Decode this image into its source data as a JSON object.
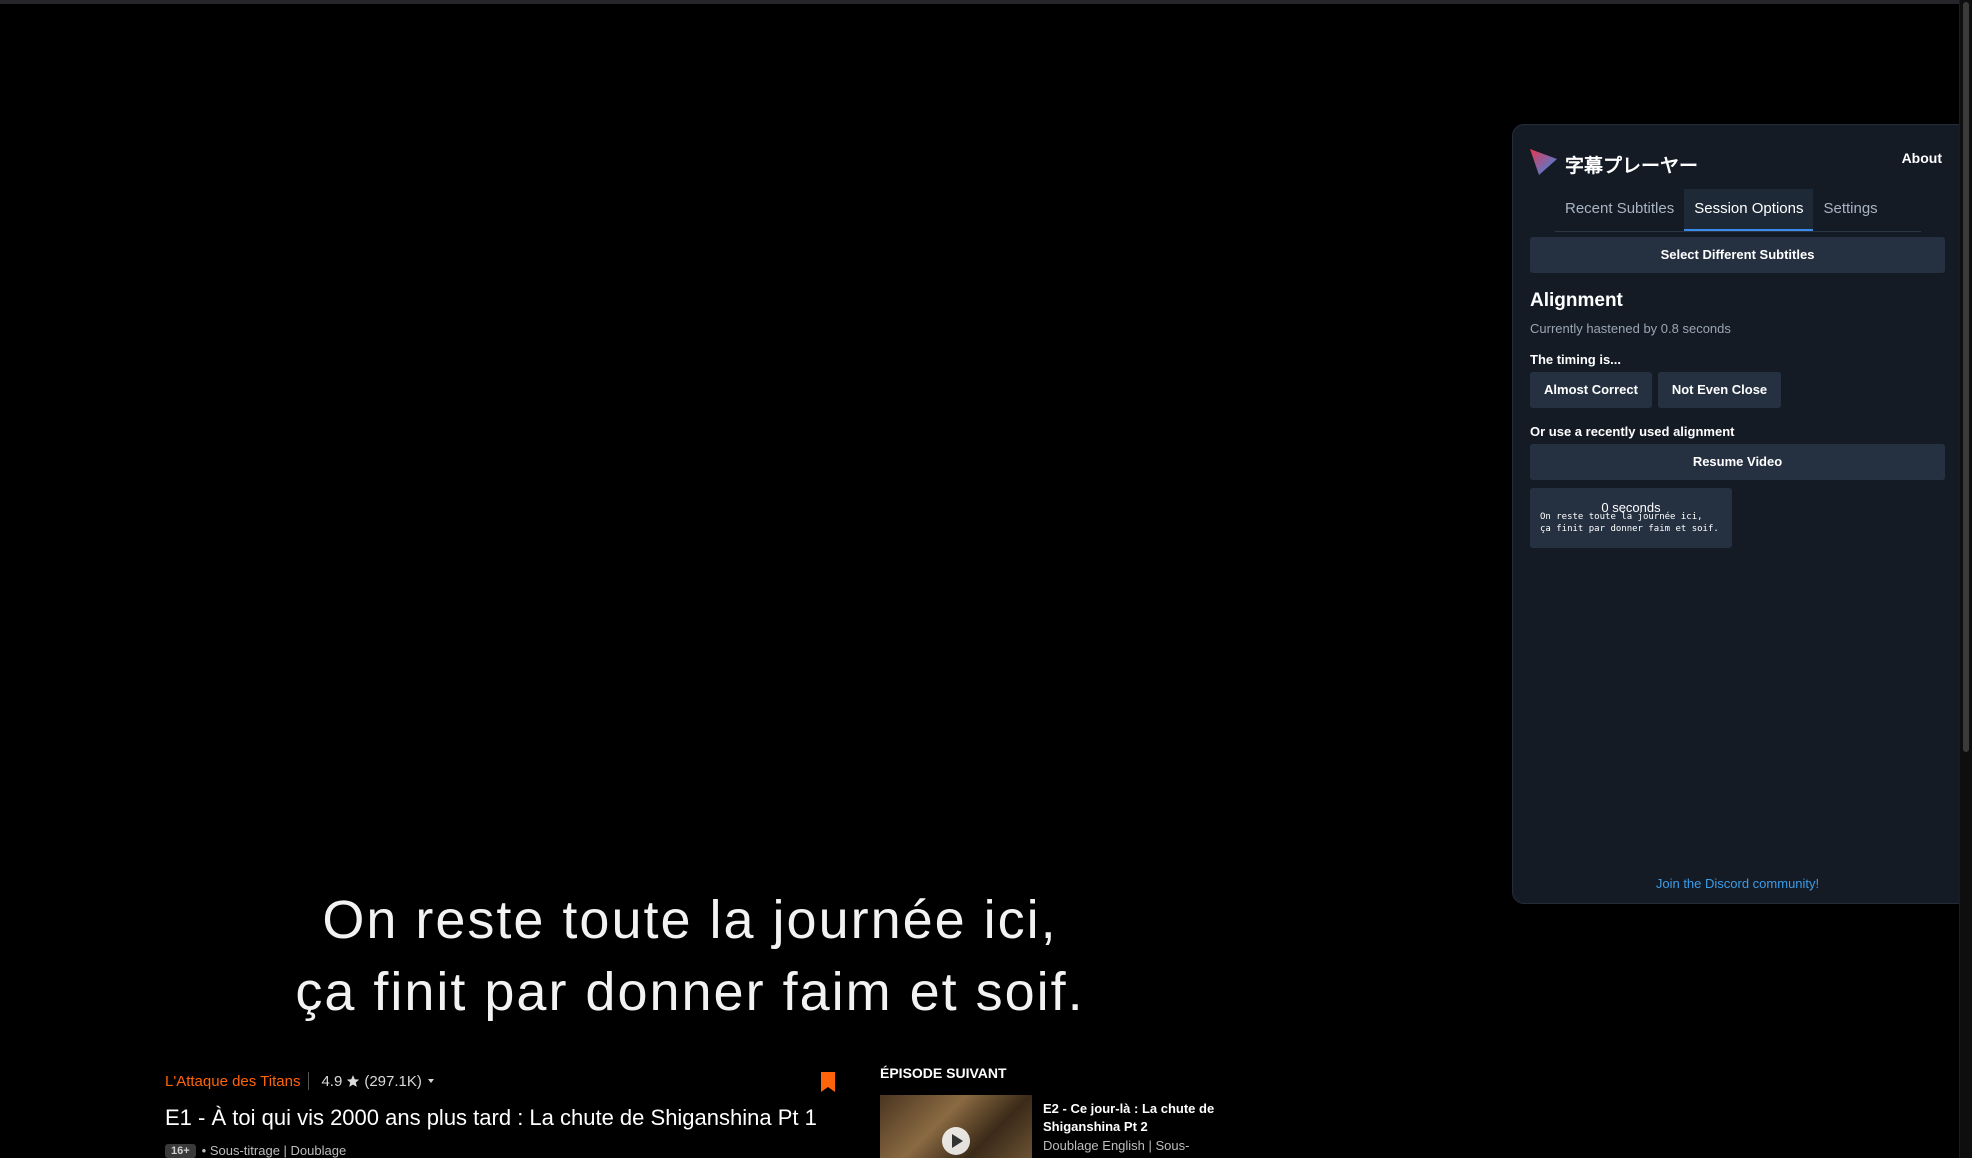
{
  "subtitle": {
    "line1": "On reste toute la journée ici,",
    "line2": "ça finit par donner faim et soif."
  },
  "episode": {
    "series": "L'Attaque des Titans",
    "rating": "4.9",
    "rating_count": "(297.1K)",
    "title": "E1 - À toi qui vis 2000 ans plus tard : La chute de Shiganshina Pt 1",
    "age_badge": "16+",
    "audio": "• Sous-titrage | Doublage"
  },
  "next_episode": {
    "heading": "ÉPISODE SUIVANT",
    "title": "E2 - Ce jour-là : La chute de Shiganshina Pt 2",
    "audio": "Doublage English | Sous-"
  },
  "panel": {
    "app_title": "字幕プレーヤー",
    "about": "About",
    "tabs": [
      {
        "label": "Recent Subtitles"
      },
      {
        "label": "Session Options"
      },
      {
        "label": "Settings"
      }
    ],
    "active_tab": "Session Options",
    "select_subtitles": "Select Different Subtitles",
    "alignment_heading": "Alignment",
    "alignment_status": "Currently hastened by 0.8 seconds",
    "timing_label": "The timing is...",
    "almost_correct": "Almost Correct",
    "not_even_close": "Not Even Close",
    "recent_alignment_label": "Or use a recently used alignment",
    "resume_video": "Resume Video",
    "recent_alignment": {
      "seconds": "0 seconds",
      "preview_line1": "On reste toute la journée ici,",
      "preview_line2": "ça finit par donner faim et soif."
    },
    "discord": "Join the Discord community!"
  },
  "colors": {
    "accent": "#ff640a",
    "panel_bg": "#141b25",
    "button_bg": "#253141",
    "tab_active": "#3b8beb",
    "link": "#3b9ce8"
  },
  "icons": [
    "logo-icon",
    "star-icon",
    "caret-down-icon",
    "bookmark-icon",
    "play-icon"
  ]
}
